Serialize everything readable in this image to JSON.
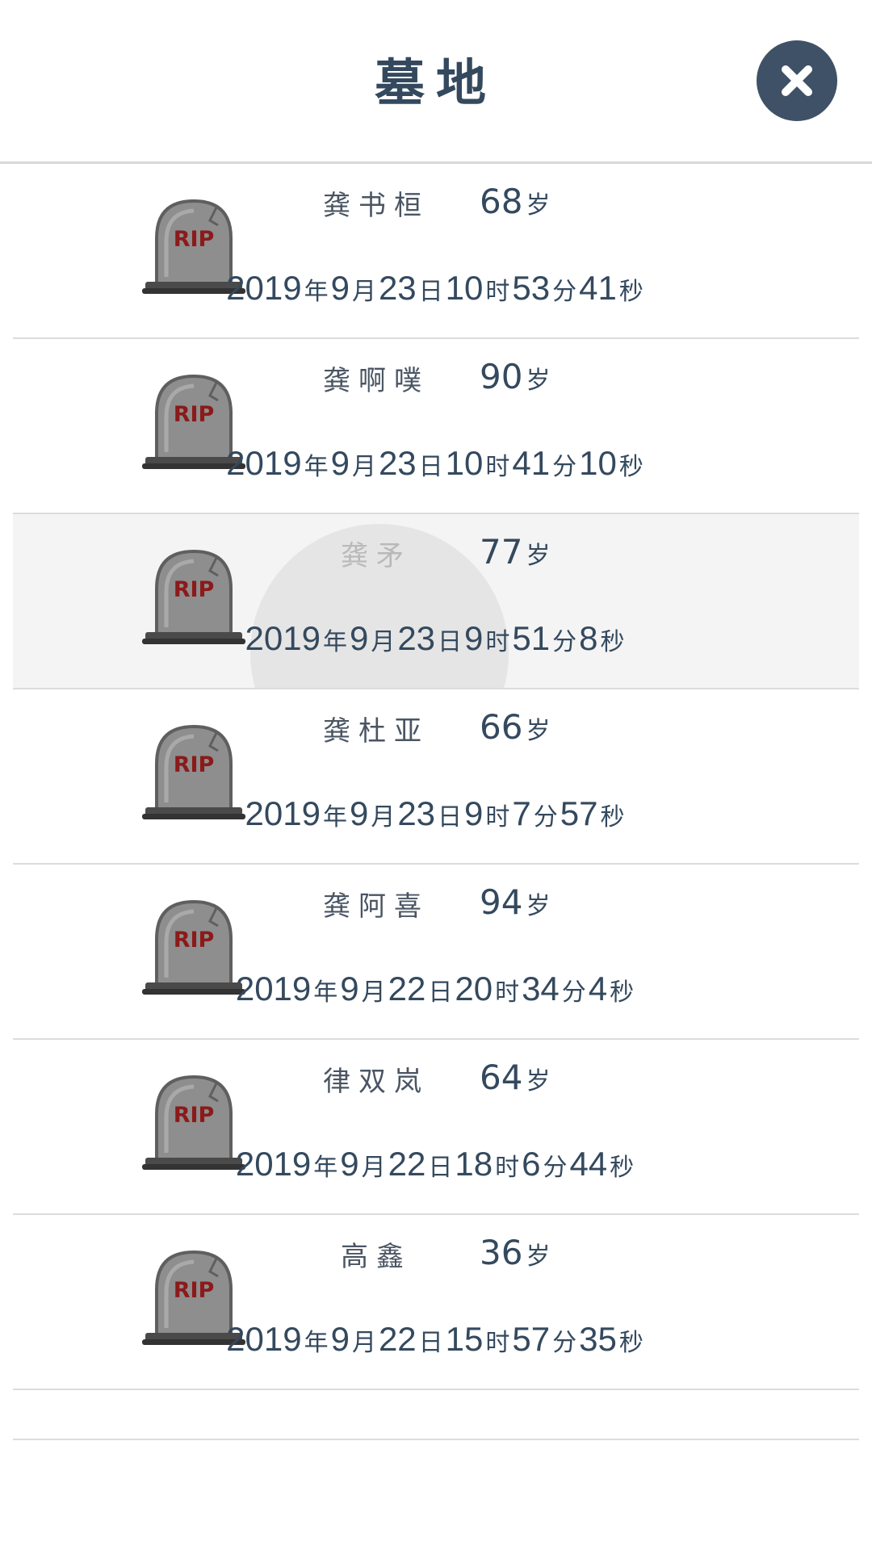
{
  "header": {
    "title": "墓地",
    "close_icon": "close-icon"
  },
  "units": {
    "age": "岁",
    "year": "年",
    "month": "月",
    "day": "日",
    "hour": "时",
    "minute": "分",
    "second": "秒"
  },
  "icons": {
    "tombstone": "tombstone-rip-icon",
    "tombstone_text": "RIP"
  },
  "graves": [
    {
      "name": "龚书桓",
      "age": "68",
      "year": "2019",
      "month": "9",
      "day": "23",
      "hour": "10",
      "minute": "53",
      "second": "41"
    },
    {
      "name": "龚啊噗",
      "age": "90",
      "year": "2019",
      "month": "9",
      "day": "23",
      "hour": "10",
      "minute": "41",
      "second": "10"
    },
    {
      "name": "龚矛",
      "age": "77",
      "year": "2019",
      "month": "9",
      "day": "23",
      "hour": "9",
      "minute": "51",
      "second": "8",
      "pressed": true
    },
    {
      "name": "龚杜亚",
      "age": "66",
      "year": "2019",
      "month": "9",
      "day": "23",
      "hour": "9",
      "minute": "7",
      "second": "57"
    },
    {
      "name": "龚阿喜",
      "age": "94",
      "year": "2019",
      "month": "9",
      "day": "22",
      "hour": "20",
      "minute": "34",
      "second": "4"
    },
    {
      "name": "律双岚",
      "age": "64",
      "year": "2019",
      "month": "9",
      "day": "22",
      "hour": "18",
      "minute": "6",
      "second": "44"
    },
    {
      "name": "高鑫",
      "age": "36",
      "year": "2019",
      "month": "9",
      "day": "22",
      "hour": "15",
      "minute": "57",
      "second": "35"
    }
  ]
}
